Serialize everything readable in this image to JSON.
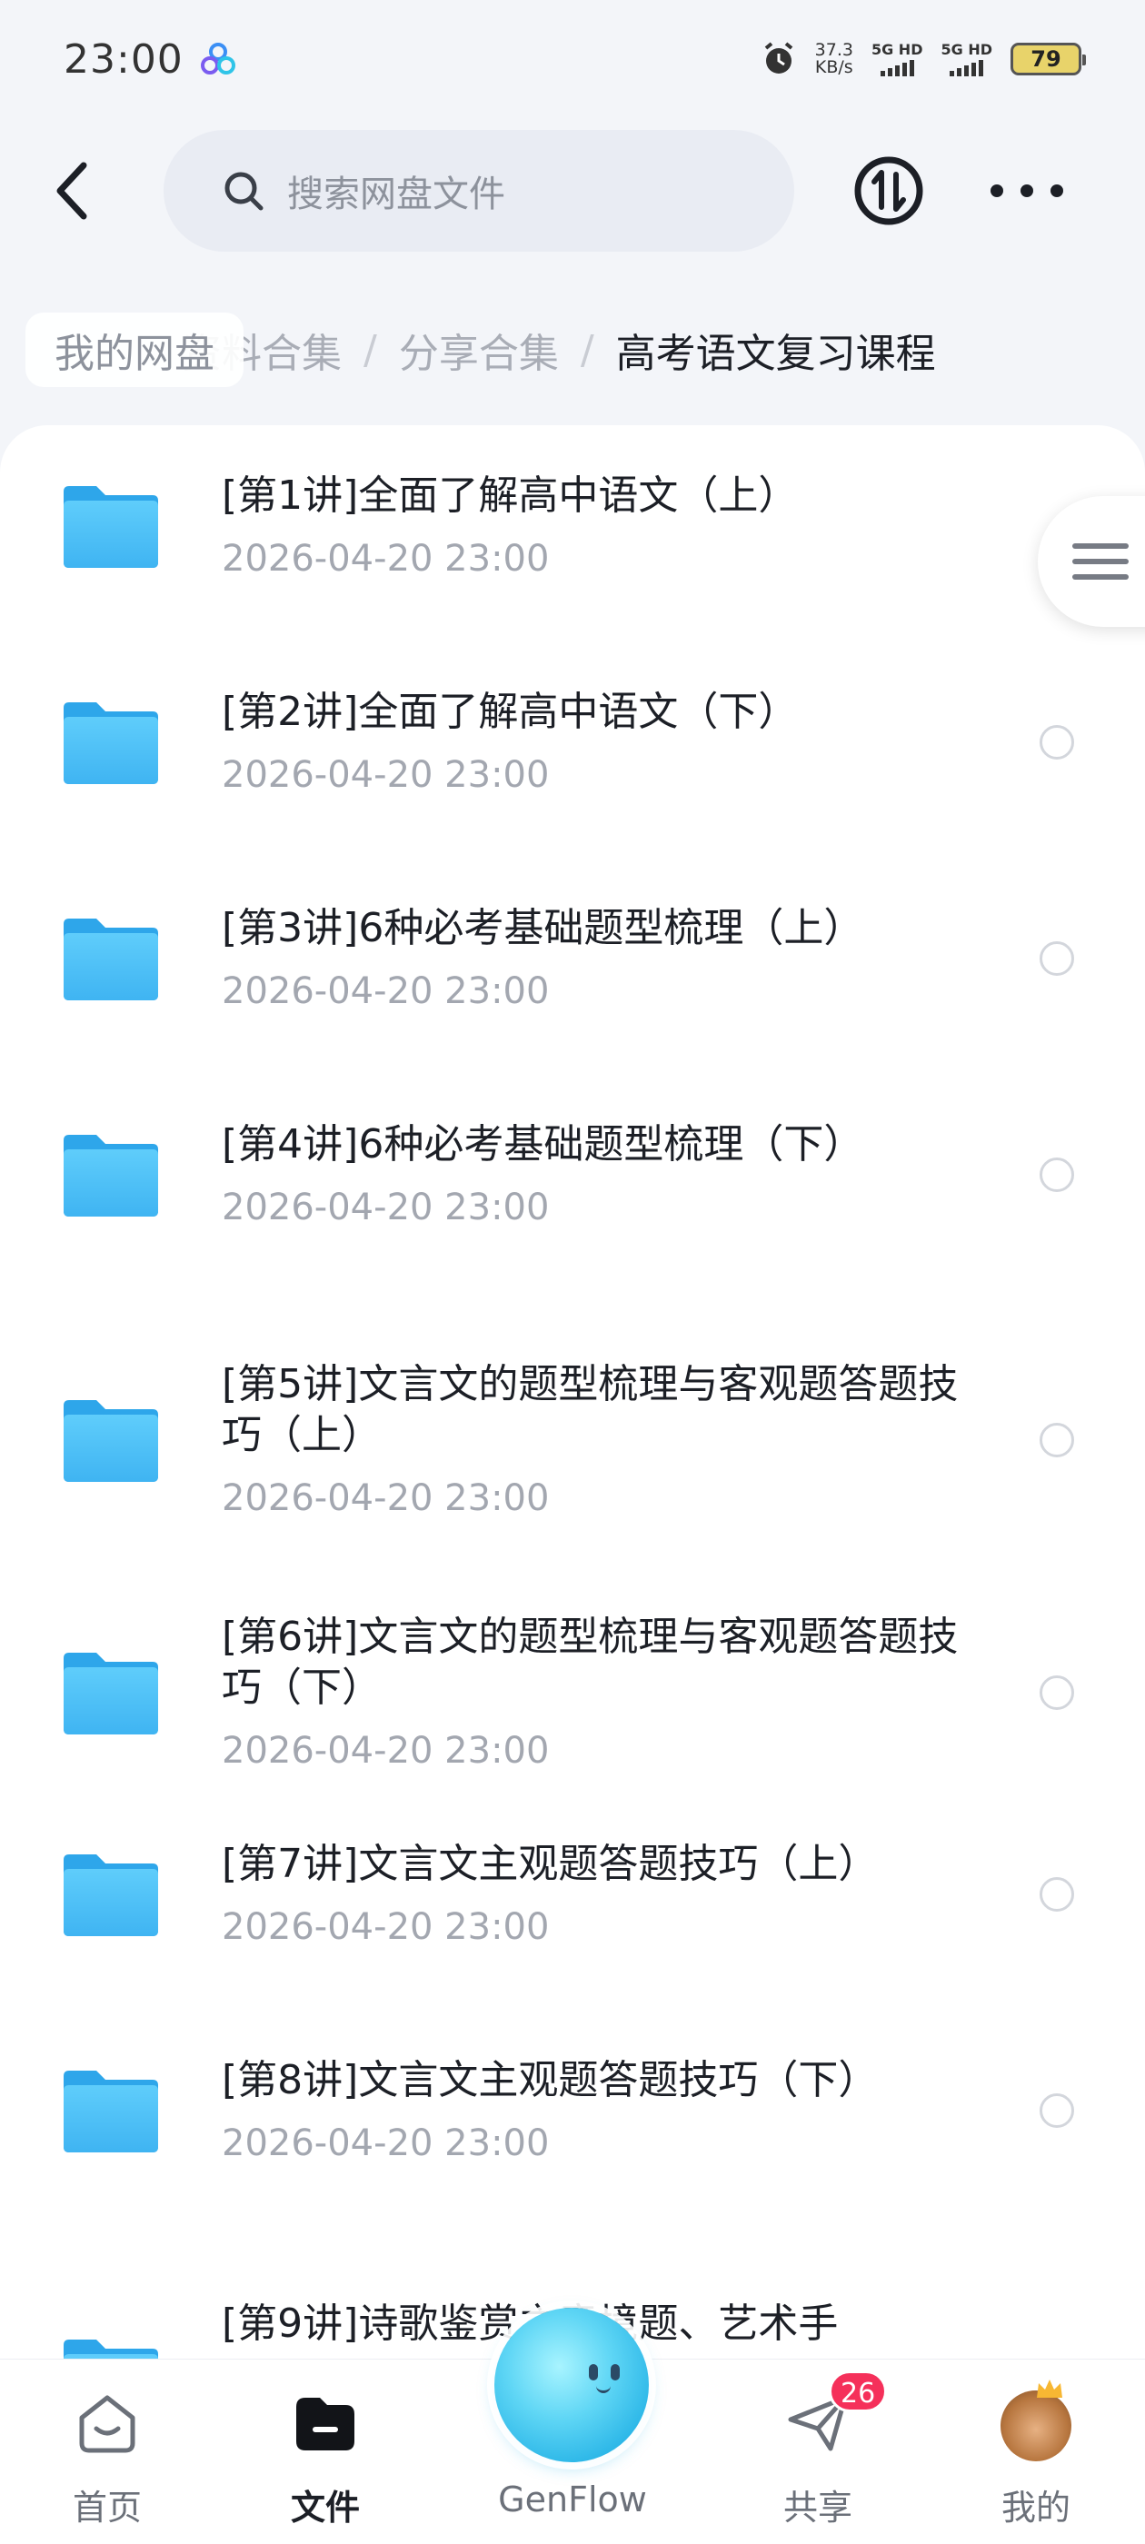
{
  "status_bar": {
    "time": "23:00",
    "net_speed_value": "37.3",
    "net_speed_unit": "KB/s",
    "sim1_label": "5G HD",
    "sim2_label": "5G HD",
    "battery": "79"
  },
  "top_bar": {
    "search_placeholder": "搜索网盘文件"
  },
  "breadcrumb": {
    "home": "我的网盘",
    "path": [
      "资料合集",
      "分享合集"
    ],
    "current": "高考语文复习课程",
    "separator": "/"
  },
  "files": [
    {
      "title": "[第1讲]全面了解高中语文（上）",
      "date": "2026-04-20  23:00"
    },
    {
      "title": "[第2讲]全面了解高中语文（下）",
      "date": "2026-04-20  23:00"
    },
    {
      "title": "[第3讲]6种必考基础题型梳理（上）",
      "date": "2026-04-20  23:00"
    },
    {
      "title": "[第4讲]6种必考基础题型梳理（下）",
      "date": "2026-04-20  23:00"
    },
    {
      "title": "[第5讲]文言文的题型梳理与客观题答题技巧（上）",
      "date": "2026-04-20  23:00"
    },
    {
      "title": "[第6讲]文言文的题型梳理与客观题答题技巧（下）",
      "date": "2026-04-20  23:00"
    },
    {
      "title": "[第7讲]文言文主观题答题技巧（上）",
      "date": "2026-04-20  23:00"
    },
    {
      "title": "[第8讲]文言文主观题答题技巧（下）",
      "date": "2026-04-20  23:00"
    },
    {
      "title": "[第9讲]诗歌鉴赏之意境题、艺术手",
      "date": ""
    }
  ],
  "bottom_nav": {
    "home": "首页",
    "files": "文件",
    "genflow": "GenFlow",
    "share": "共享",
    "share_badge": "26",
    "mine": "我的"
  },
  "colors": {
    "folder": "#4cc2f7",
    "badge": "#f5305a",
    "orb": "#26b3e6"
  }
}
